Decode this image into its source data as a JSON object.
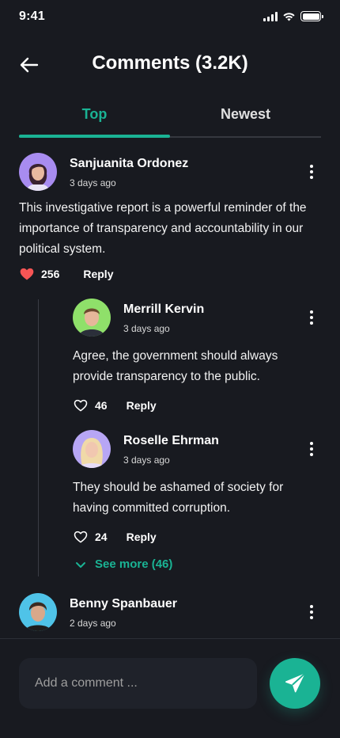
{
  "status_bar": {
    "time": "9:41"
  },
  "header": {
    "title": "Comments (3.2K)"
  },
  "tabs": [
    {
      "label": "Top",
      "active": true
    },
    {
      "label": "Newest",
      "active": false
    }
  ],
  "comments": [
    {
      "name": "Sanjuanita Ordonez",
      "time": "3 days ago",
      "text": "This investigative report is a powerful reminder of the importance of transparency and accountability in our political system.",
      "likes": "256",
      "liked": true,
      "reply_label": "Reply",
      "avatar_color": "#a88cf0"
    },
    {
      "name": "Merrill Kervin",
      "time": "3 days ago",
      "text": "Agree, the government should always provide transparency to the public.",
      "likes": "46",
      "liked": false,
      "reply_label": "Reply",
      "avatar_color": "#8fe06a"
    },
    {
      "name": "Roselle Ehrman",
      "time": "3 days ago",
      "text": "They should be ashamed of society for having committed corruption.",
      "likes": "24",
      "liked": false,
      "reply_label": "Reply",
      "avatar_color": "#b7a6f5"
    },
    {
      "name": "Benny Spanbauer",
      "time": "2 days ago",
      "avatar_color": "#4fc3e8"
    }
  ],
  "see_more": {
    "label": "See more (46)"
  },
  "composer": {
    "placeholder": "Add a comment ..."
  },
  "colors": {
    "accent": "#1ab394",
    "background": "#181a20",
    "liked_heart": "#f75555"
  }
}
